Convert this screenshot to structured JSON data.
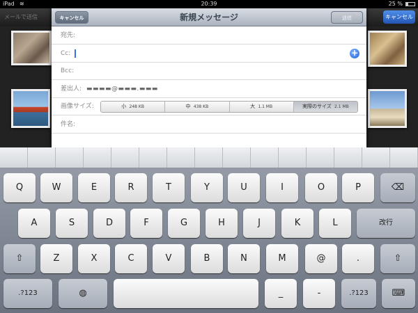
{
  "status_bar": {
    "carrier": "iPad",
    "time": "20:39",
    "battery_pct": "25 %",
    "battery_level": 0.25,
    "wifi_icon": "wifi-icon"
  },
  "background_app": {
    "left_button": "メールで送信",
    "right_button": "キャンセル"
  },
  "compose": {
    "title": "新規メッセージ",
    "cancel_label": "キャンセル",
    "send_label": "送信",
    "to_label": "宛先:",
    "cc_label": "Cc:",
    "bcc_label": "Bcc:",
    "from_label": "差出人:",
    "from_value": "▬▬▬▬@▬▬▬.▬▬▬",
    "image_size_label": "画像サイズ:",
    "image_sizes": [
      {
        "name": "小",
        "size": "248 KB",
        "selected": false
      },
      {
        "name": "中",
        "size": "438 KB",
        "selected": false
      },
      {
        "name": "大",
        "size": "1.1 MB",
        "selected": false
      },
      {
        "name": "実際のサイズ",
        "size": "2.1 MB",
        "selected": true
      }
    ],
    "subject_label": "件名:"
  },
  "keyboard": {
    "row1": [
      "Q",
      "W",
      "E",
      "R",
      "T",
      "Y",
      "U",
      "I",
      "O",
      "P"
    ],
    "row2": [
      "A",
      "S",
      "D",
      "F",
      "G",
      "H",
      "J",
      "K",
      "L"
    ],
    "row3": [
      "Z",
      "X",
      "C",
      "V",
      "B",
      "N",
      "M",
      "@",
      "."
    ],
    "backspace_icon": "backspace-icon",
    "return_label": "改行",
    "shift_icon": "shift-icon",
    "numbers_label": ".?123",
    "globe_icon": "globe-icon",
    "underscore_label": "_",
    "dash_label": "-",
    "hide_keyboard_icon": "keyboard-hide-icon"
  }
}
